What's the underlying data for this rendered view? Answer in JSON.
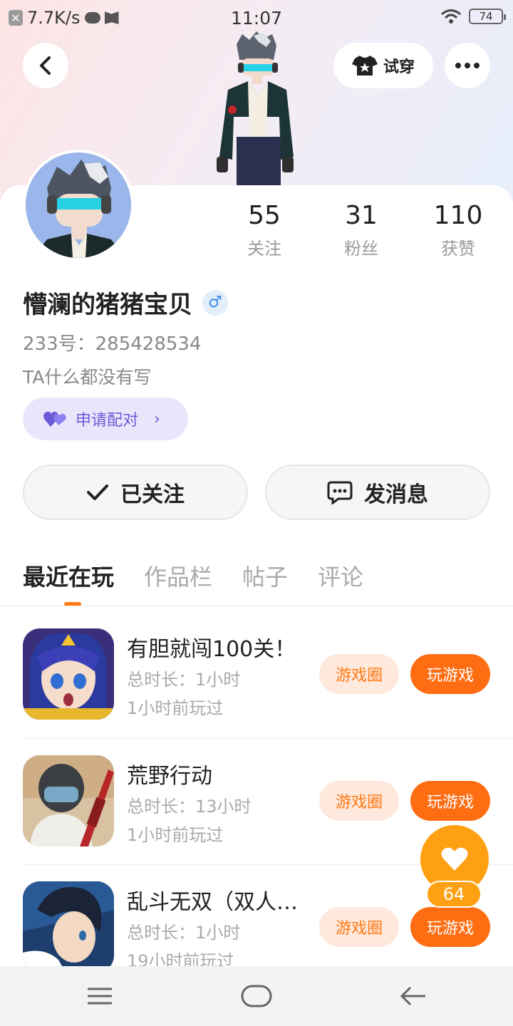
{
  "status_bar": {
    "speed": "7.7K/s",
    "time": "11:07",
    "battery": "74"
  },
  "header": {
    "tryon_label": "试穿"
  },
  "profile": {
    "stats": [
      {
        "value": "55",
        "label": "关注"
      },
      {
        "value": "31",
        "label": "粉丝"
      },
      {
        "value": "110",
        "label": "获赞"
      }
    ],
    "username": "懵澜的猪猪宝贝",
    "gender_symbol": "♂",
    "uid": "233号：285428534",
    "bio": "TA什么都没有写",
    "pair_label": "申请配对"
  },
  "actions": {
    "follow_label": "已关注",
    "message_label": "发消息"
  },
  "tabs": [
    {
      "label": "最近在玩"
    },
    {
      "label": "作品栏"
    },
    {
      "label": "帖子"
    },
    {
      "label": "评论"
    }
  ],
  "games": [
    {
      "name": "有胆就闯100关！",
      "duration": "总时长：1小时",
      "last_played": "1小时前玩过",
      "circle_label": "游戏圈",
      "play_label": "玩游戏"
    },
    {
      "name": "荒野行动",
      "duration": "总时长：13小时",
      "last_played": "1小时前玩过",
      "circle_label": "游戏圈",
      "play_label": "玩游戏"
    },
    {
      "name": "乱斗无双（双人…",
      "duration": "总时长：1小时",
      "last_played": "19小时前玩过",
      "circle_label": "游戏圈",
      "play_label": "玩游戏"
    }
  ],
  "like_float": {
    "count": "64"
  },
  "colors": {
    "accent_orange": "#ff6d12",
    "like_orange": "#ffa012",
    "pair_purple": "#6b5bd6"
  }
}
